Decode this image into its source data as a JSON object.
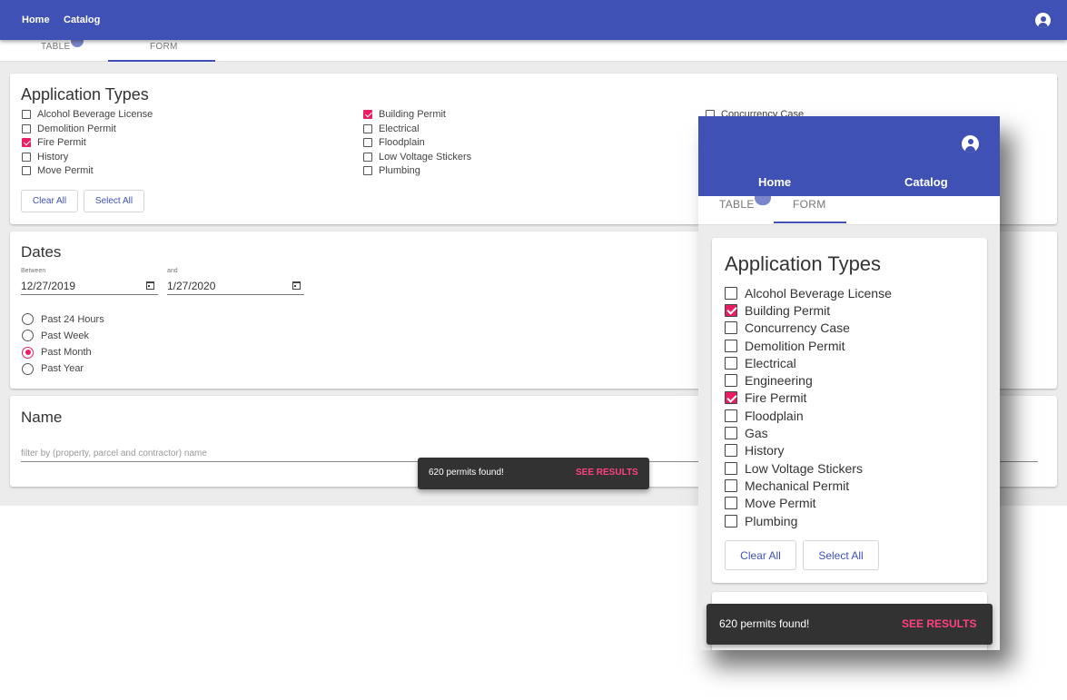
{
  "desktop": {
    "nav": {
      "home": "Home",
      "catalog": "Catalog"
    },
    "tabs": {
      "table": "TABLE",
      "form": "FORM"
    },
    "app_types": {
      "title": "Application Types",
      "col1": [
        {
          "label": "Alcohol Beverage License",
          "checked": false
        },
        {
          "label": "Demolition Permit",
          "checked": false
        },
        {
          "label": "Fire Permit",
          "checked": true
        },
        {
          "label": "History",
          "checked": false
        },
        {
          "label": "Move Permit",
          "checked": false
        }
      ],
      "col2": [
        {
          "label": "Building Permit",
          "checked": true
        },
        {
          "label": "Electrical",
          "checked": false
        },
        {
          "label": "Floodplain",
          "checked": false
        },
        {
          "label": "Low Voltage Stickers",
          "checked": false
        },
        {
          "label": "Plumbing",
          "checked": false
        }
      ],
      "col3": [
        {
          "label": "Concurrency Case",
          "checked": false
        }
      ],
      "clear_all": "Clear All",
      "select_all": "Select All"
    },
    "dates": {
      "title": "Dates",
      "between_label": "Between",
      "and_label": "and",
      "start": "12/27/2019",
      "end": "1/27/2020",
      "options": [
        {
          "label": "Past 24 Hours",
          "selected": false
        },
        {
          "label": "Past Week",
          "selected": false
        },
        {
          "label": "Past Month",
          "selected": true
        },
        {
          "label": "Past Year",
          "selected": false
        }
      ]
    },
    "name": {
      "title": "Name",
      "placeholder": "filter by (property, parcel and contractor) name"
    },
    "snackbar": {
      "message": "620 permits found!",
      "action": "SEE RESULTS"
    }
  },
  "mobile": {
    "nav": {
      "home": "Home",
      "catalog": "Catalog"
    },
    "tabs": {
      "table": "TABLE",
      "form": "FORM"
    },
    "app_types": {
      "title": "Application Types",
      "items": [
        {
          "label": "Alcohol Beverage License",
          "checked": false
        },
        {
          "label": "Building Permit",
          "checked": true
        },
        {
          "label": "Concurrency Case",
          "checked": false
        },
        {
          "label": "Demolition Permit",
          "checked": false
        },
        {
          "label": "Electrical",
          "checked": false
        },
        {
          "label": "Engineering",
          "checked": false
        },
        {
          "label": "Fire Permit",
          "checked": true
        },
        {
          "label": "Floodplain",
          "checked": false
        },
        {
          "label": "Gas",
          "checked": false
        },
        {
          "label": "History",
          "checked": false
        },
        {
          "label": "Low Voltage Stickers",
          "checked": false
        },
        {
          "label": "Mechanical Permit",
          "checked": false
        },
        {
          "label": "Move Permit",
          "checked": false
        },
        {
          "label": "Plumbing",
          "checked": false
        }
      ],
      "clear_all": "Clear All",
      "select_all": "Select All"
    },
    "snackbar": {
      "message": "620 permits found!",
      "action": "SEE RESULTS"
    }
  },
  "icons": {
    "account": "account-circle-icon",
    "calendar": "calendar-icon"
  },
  "colors": {
    "primary": "#3f51b5",
    "accent": "#e91e63",
    "snackbar": "#323232",
    "action": "#ff4081"
  }
}
